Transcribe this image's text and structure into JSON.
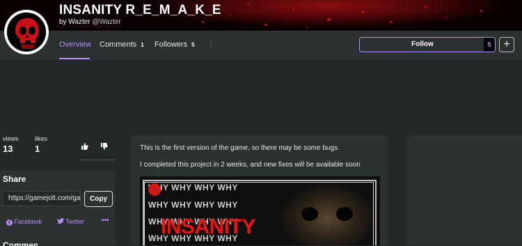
{
  "header": {
    "title": "INSANITY R_E_M_A_K_E",
    "by_prefix": "by",
    "author_name": "Wazter",
    "author_handle": "@Wazter"
  },
  "tabs": [
    {
      "label": "Overview",
      "active": true
    },
    {
      "label": "Comments",
      "count": "1"
    },
    {
      "label": "Followers",
      "count": "5"
    }
  ],
  "follow": {
    "label": "Follow",
    "count": "5",
    "plus": "+"
  },
  "stats": {
    "views_label": "views",
    "views_value": "13",
    "likes_label": "likes",
    "likes_value": "1"
  },
  "share": {
    "title": "Share",
    "url": "https://gamejolt.com/games/insanity-remake",
    "copy_label": "Copy",
    "facebook_label": "Facebook",
    "twitter_label": "Twitter",
    "more_label": "•••"
  },
  "comments_hint": "Comments",
  "description": {
    "line1": "This is the first version of the game, so there may be some bugs.",
    "line2": "I completed this project in 2 weeks, and new fixes will be available soon"
  },
  "media": {
    "why_text": "WHY WHY WHY WHY",
    "logo_text": "INSANITY"
  },
  "colors": {
    "accent": "#b88df6",
    "background": "#232828",
    "card": "#2c3232",
    "banner_red": "#c41018"
  },
  "icons": {
    "like": "thumbs-up-icon",
    "dislike": "thumbs-down-icon",
    "facebook": "facebook-icon",
    "twitter": "twitter-icon",
    "kebab": "kebab-menu-icon"
  }
}
